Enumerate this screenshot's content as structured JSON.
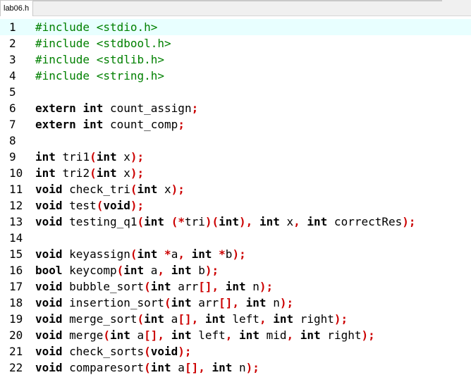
{
  "tab": {
    "label": "lab06.h"
  },
  "colors": {
    "preprocessor": "#008000",
    "keyword": "#000000",
    "operator": "#cc0000",
    "current_line": "#e8ffff"
  },
  "lines": [
    {
      "n": "1",
      "tokens": [
        [
          "pre",
          "#include <stdio.h>"
        ]
      ]
    },
    {
      "n": "2",
      "tokens": [
        [
          "pre",
          "#include <stdbool.h>"
        ]
      ]
    },
    {
      "n": "3",
      "tokens": [
        [
          "pre",
          "#include <stdlib.h>"
        ]
      ]
    },
    {
      "n": "4",
      "tokens": [
        [
          "pre",
          "#include <string.h>"
        ]
      ]
    },
    {
      "n": "5",
      "tokens": []
    },
    {
      "n": "6",
      "tokens": [
        [
          "kw",
          "extern"
        ],
        [
          "id",
          " "
        ],
        [
          "kw",
          "int"
        ],
        [
          "id",
          " count_assign"
        ],
        [
          "op",
          ";"
        ]
      ]
    },
    {
      "n": "7",
      "tokens": [
        [
          "kw",
          "extern"
        ],
        [
          "id",
          " "
        ],
        [
          "kw",
          "int"
        ],
        [
          "id",
          " count_comp"
        ],
        [
          "op",
          ";"
        ]
      ]
    },
    {
      "n": "8",
      "tokens": []
    },
    {
      "n": "9",
      "tokens": [
        [
          "kw",
          "int"
        ],
        [
          "id",
          " tri1"
        ],
        [
          "op",
          "("
        ],
        [
          "kw",
          "int"
        ],
        [
          "id",
          " x"
        ],
        [
          "op",
          ");"
        ]
      ]
    },
    {
      "n": "10",
      "tokens": [
        [
          "kw",
          "int"
        ],
        [
          "id",
          " tri2"
        ],
        [
          "op",
          "("
        ],
        [
          "kw",
          "int"
        ],
        [
          "id",
          " x"
        ],
        [
          "op",
          ");"
        ]
      ]
    },
    {
      "n": "11",
      "tokens": [
        [
          "kw",
          "void"
        ],
        [
          "id",
          " check_tri"
        ],
        [
          "op",
          "("
        ],
        [
          "kw",
          "int"
        ],
        [
          "id",
          " x"
        ],
        [
          "op",
          ");"
        ]
      ]
    },
    {
      "n": "12",
      "tokens": [
        [
          "kw",
          "void"
        ],
        [
          "id",
          " test"
        ],
        [
          "op",
          "("
        ],
        [
          "kw",
          "void"
        ],
        [
          "op",
          ");"
        ]
      ]
    },
    {
      "n": "13",
      "tokens": [
        [
          "kw",
          "void"
        ],
        [
          "id",
          " testing_q1"
        ],
        [
          "op",
          "("
        ],
        [
          "kw",
          "int"
        ],
        [
          "id",
          " "
        ],
        [
          "op",
          "(*"
        ],
        [
          "id",
          "tri"
        ],
        [
          "op",
          ")("
        ],
        [
          "kw",
          "int"
        ],
        [
          "op",
          "),"
        ],
        [
          "id",
          " "
        ],
        [
          "kw",
          "int"
        ],
        [
          "id",
          " x"
        ],
        [
          "op",
          ","
        ],
        [
          "id",
          " "
        ],
        [
          "kw",
          "int"
        ],
        [
          "id",
          " correctRes"
        ],
        [
          "op",
          ");"
        ]
      ]
    },
    {
      "n": "14",
      "tokens": []
    },
    {
      "n": "15",
      "tokens": [
        [
          "kw",
          "void"
        ],
        [
          "id",
          " keyassign"
        ],
        [
          "op",
          "("
        ],
        [
          "kw",
          "int"
        ],
        [
          "id",
          " "
        ],
        [
          "op",
          "*"
        ],
        [
          "id",
          "a"
        ],
        [
          "op",
          ","
        ],
        [
          "id",
          " "
        ],
        [
          "kw",
          "int"
        ],
        [
          "id",
          " "
        ],
        [
          "op",
          "*"
        ],
        [
          "id",
          "b"
        ],
        [
          "op",
          ");"
        ]
      ]
    },
    {
      "n": "16",
      "tokens": [
        [
          "kw",
          "bool"
        ],
        [
          "id",
          " keycomp"
        ],
        [
          "op",
          "("
        ],
        [
          "kw",
          "int"
        ],
        [
          "id",
          " a"
        ],
        [
          "op",
          ","
        ],
        [
          "id",
          " "
        ],
        [
          "kw",
          "int"
        ],
        [
          "id",
          " b"
        ],
        [
          "op",
          ");"
        ]
      ]
    },
    {
      "n": "17",
      "tokens": [
        [
          "kw",
          "void"
        ],
        [
          "id",
          " bubble_sort"
        ],
        [
          "op",
          "("
        ],
        [
          "kw",
          "int"
        ],
        [
          "id",
          " arr"
        ],
        [
          "op",
          "[],"
        ],
        [
          "id",
          " "
        ],
        [
          "kw",
          "int"
        ],
        [
          "id",
          " n"
        ],
        [
          "op",
          ");"
        ]
      ]
    },
    {
      "n": "18",
      "tokens": [
        [
          "kw",
          "void"
        ],
        [
          "id",
          " insertion_sort"
        ],
        [
          "op",
          "("
        ],
        [
          "kw",
          "int"
        ],
        [
          "id",
          " arr"
        ],
        [
          "op",
          "[],"
        ],
        [
          "id",
          " "
        ],
        [
          "kw",
          "int"
        ],
        [
          "id",
          " n"
        ],
        [
          "op",
          ");"
        ]
      ]
    },
    {
      "n": "19",
      "tokens": [
        [
          "kw",
          "void"
        ],
        [
          "id",
          " merge_sort"
        ],
        [
          "op",
          "("
        ],
        [
          "kw",
          "int"
        ],
        [
          "id",
          " a"
        ],
        [
          "op",
          "[],"
        ],
        [
          "id",
          " "
        ],
        [
          "kw",
          "int"
        ],
        [
          "id",
          " left"
        ],
        [
          "op",
          ","
        ],
        [
          "id",
          " "
        ],
        [
          "kw",
          "int"
        ],
        [
          "id",
          " right"
        ],
        [
          "op",
          ");"
        ]
      ]
    },
    {
      "n": "20",
      "tokens": [
        [
          "kw",
          "void"
        ],
        [
          "id",
          " merge"
        ],
        [
          "op",
          "("
        ],
        [
          "kw",
          "int"
        ],
        [
          "id",
          " a"
        ],
        [
          "op",
          "[],"
        ],
        [
          "id",
          " "
        ],
        [
          "kw",
          "int"
        ],
        [
          "id",
          " left"
        ],
        [
          "op",
          ","
        ],
        [
          "id",
          " "
        ],
        [
          "kw",
          "int"
        ],
        [
          "id",
          " mid"
        ],
        [
          "op",
          ","
        ],
        [
          "id",
          " "
        ],
        [
          "kw",
          "int"
        ],
        [
          "id",
          " right"
        ],
        [
          "op",
          ");"
        ]
      ]
    },
    {
      "n": "21",
      "tokens": [
        [
          "kw",
          "void"
        ],
        [
          "id",
          " check_sorts"
        ],
        [
          "op",
          "("
        ],
        [
          "kw",
          "void"
        ],
        [
          "op",
          ");"
        ]
      ]
    },
    {
      "n": "22",
      "tokens": [
        [
          "kw",
          "void"
        ],
        [
          "id",
          " comparesort"
        ],
        [
          "op",
          "("
        ],
        [
          "kw",
          "int"
        ],
        [
          "id",
          " a"
        ],
        [
          "op",
          "[],"
        ],
        [
          "id",
          " "
        ],
        [
          "kw",
          "int"
        ],
        [
          "id",
          " n"
        ],
        [
          "op",
          ");"
        ]
      ]
    }
  ],
  "current_line": "1"
}
